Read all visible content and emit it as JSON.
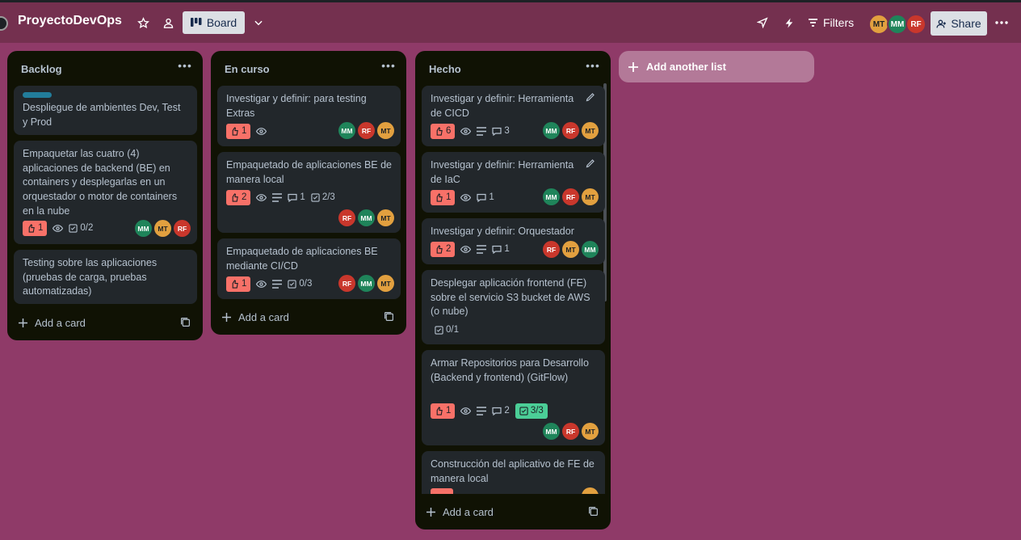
{
  "colors": {
    "board_background": "#8f3a68",
    "header_background": "#74304f",
    "list_background": "#101204",
    "card_background": "#22272b",
    "vote_badge": "#f87168",
    "checklist_done_badge": "#4bce97",
    "label_blue": "#227d9b"
  },
  "header": {
    "board_title": "ProyectoDevOps",
    "view_label": "Board",
    "filters_label": "Filters",
    "share_label": "Share",
    "members": [
      "MT",
      "MM",
      "RF"
    ],
    "icons": [
      "star-icon",
      "workspace-visible-icon",
      "board-view-icon",
      "chevron-down-icon",
      "power-ups-icon",
      "automation-icon",
      "filter-icon",
      "share-person-icon",
      "more-icon"
    ]
  },
  "lists": [
    {
      "title": "Backlog",
      "add_card": "Add a card",
      "cards": [
        {
          "title": "Despliegue de ambientes Dev, Test y Prod",
          "label": "blue"
        },
        {
          "title": "Empaquetar las cuatro (4) aplicaciones de backend (BE) en containers y desplegarlas en un orquestador o motor de containers en la nube",
          "votes": "1",
          "checklist": "0/2",
          "members": [
            "MM",
            "MT",
            "RF"
          ]
        },
        {
          "title": "Testing sobre las aplicaciones (pruebas de carga, pruebas automatizadas)"
        }
      ]
    },
    {
      "title": "En curso",
      "add_card": "Add a card",
      "cards": [
        {
          "title": "Investigar y definir: para testing Extras",
          "votes": "1",
          "members": [
            "MM",
            "RF",
            "MT"
          ]
        },
        {
          "title": "Empaquetado de aplicaciones BE de manera local",
          "votes": "2",
          "comments": "1",
          "checklist": "2/3",
          "members": [
            "RF",
            "MM",
            "MT"
          ]
        },
        {
          "title": "Empaquetado de aplicaciones BE mediante CI/CD",
          "votes": "1",
          "checklist": "0/3",
          "members": [
            "RF",
            "MM",
            "MT"
          ]
        }
      ]
    },
    {
      "title": "Hecho",
      "add_card": "Add a card",
      "cards": [
        {
          "title": "Investigar y definir: Herramienta de CICD",
          "votes": "6",
          "comments": "3",
          "members": [
            "MM",
            "RF",
            "MT"
          ]
        },
        {
          "title": "Investigar y definir: Herramienta de IaC",
          "votes": "1",
          "comments": "1",
          "members": [
            "MM",
            "RF",
            "MT"
          ]
        },
        {
          "title": "Investigar y definir: Orquestador",
          "votes": "2",
          "comments": "1",
          "members": [
            "RF",
            "MT",
            "MM"
          ]
        },
        {
          "title": "Desplegar aplicación frontend (FE) sobre el servicio S3 bucket de AWS (o nube)",
          "checklist": "0/1"
        },
        {
          "title": "Armar Repositorios para Desarrollo (Backend y frontend) (GitFlow)",
          "votes": "1",
          "comments": "2",
          "checklist": "3/3",
          "members": [
            "MM",
            "RF",
            "MT"
          ]
        },
        {
          "title": "Construcción del aplicativo de FE de manera local"
        }
      ]
    }
  ],
  "add_list": "Add another list"
}
